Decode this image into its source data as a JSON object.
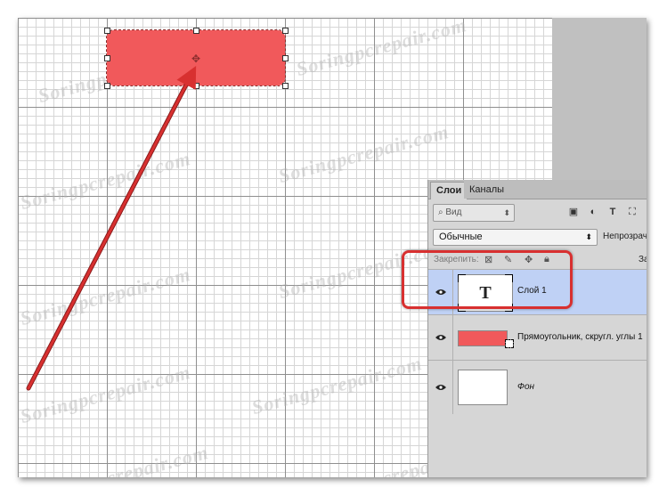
{
  "panel": {
    "tabs": [
      "Слои",
      "Каналы"
    ],
    "filter": {
      "placeholder": "Вид"
    },
    "blend_mode": "Обычные",
    "opacity_label": "Непрозрачн",
    "lock_label": "Закрепить:",
    "fill_label": "За",
    "layers": [
      {
        "name": "Слой 1",
        "type": "text",
        "thumb_glyph": "T",
        "selected": true
      },
      {
        "name": "Прямоугольник, скругл. углы 1",
        "type": "shape",
        "selected": false
      },
      {
        "name": "Фон",
        "type": "background",
        "selected": false
      }
    ]
  },
  "watermark": "Soringpcrepair.com",
  "colors": {
    "shape_fill": "#f1595b",
    "selected_layer": "#bfd1f5",
    "annotation": "#d83030"
  },
  "icons": [
    "search-icon",
    "image-filter-icon",
    "adjustment-filter-icon",
    "type-filter-icon",
    "transform-filter-icon",
    "lock-pixels-icon",
    "lock-brush-icon",
    "lock-move-icon",
    "lock-all-icon",
    "eye-icon"
  ]
}
